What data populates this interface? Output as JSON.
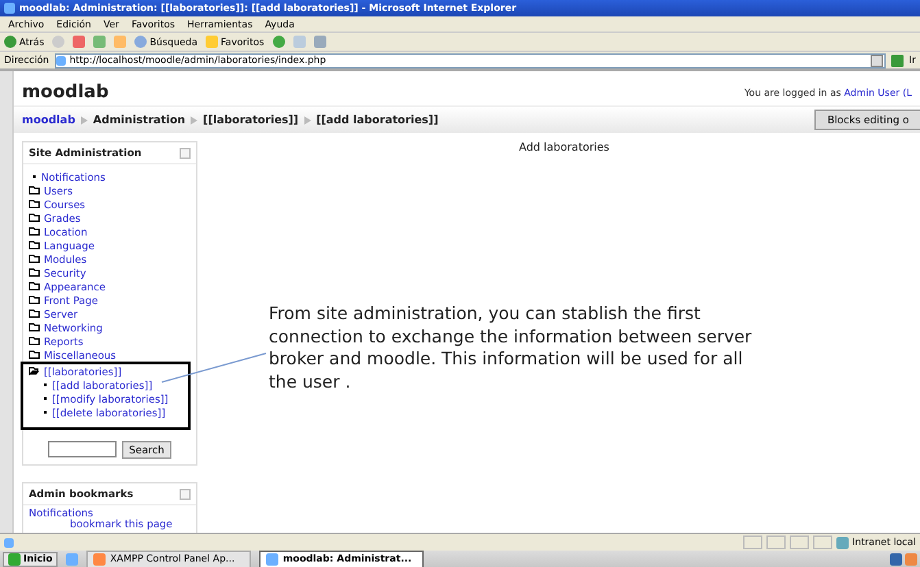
{
  "window": {
    "title": "moodlab: Administration: [[laboratories]]: [[add laboratories]] - Microsoft Internet Explorer"
  },
  "menu": [
    "Archivo",
    "Edición",
    "Ver",
    "Favoritos",
    "Herramientas",
    "Ayuda"
  ],
  "toolbar": {
    "back": "Atrás",
    "search": "Búsqueda",
    "favorites": "Favoritos"
  },
  "address": {
    "label": "Dirección",
    "value": "http://localhost/moodle/admin/laboratories/index.php",
    "go": "Ir"
  },
  "page": {
    "site_name": "moodlab",
    "login_text": "You are logged in as",
    "login_user": "Admin User (L",
    "breadcrumb": [
      {
        "label": "moodlab",
        "link": true
      },
      {
        "label": "Administration",
        "link": false
      },
      {
        "label": "[[laboratories]]",
        "link": false
      },
      {
        "label": "[[add laboratories]]",
        "link": false
      }
    ],
    "blocks_button": "Blocks editing o",
    "heading": "Add laboratories"
  },
  "sidebar": {
    "title": "Site Administration",
    "items": [
      {
        "label": "Notifications",
        "kind": "leaf"
      },
      {
        "label": "Users",
        "kind": "folder",
        "expanded": false
      },
      {
        "label": "Courses",
        "kind": "folder",
        "expanded": false
      },
      {
        "label": "Grades",
        "kind": "folder",
        "expanded": false
      },
      {
        "label": "Location",
        "kind": "folder",
        "expanded": false
      },
      {
        "label": "Language",
        "kind": "folder",
        "expanded": false
      },
      {
        "label": "Modules",
        "kind": "folder",
        "expanded": false
      },
      {
        "label": "Security",
        "kind": "folder",
        "expanded": false
      },
      {
        "label": "Appearance",
        "kind": "folder",
        "expanded": false
      },
      {
        "label": "Front Page",
        "kind": "folder",
        "expanded": false
      },
      {
        "label": "Server",
        "kind": "folder",
        "expanded": false
      },
      {
        "label": "Networking",
        "kind": "folder",
        "expanded": false
      },
      {
        "label": "Reports",
        "kind": "folder",
        "expanded": false
      },
      {
        "label": "Miscellaneous",
        "kind": "folder",
        "expanded": false
      },
      {
        "label": "[[laboratories]]",
        "kind": "folder",
        "expanded": true,
        "children": [
          {
            "label": "[[add laboratories]]"
          },
          {
            "label": "[[modify laboratories]]"
          },
          {
            "label": "[[delete laboratories]]"
          }
        ]
      }
    ],
    "search_button": "Search"
  },
  "bookmarks": {
    "title": "Admin bookmarks",
    "items": [
      "Notifications",
      "bookmark this page"
    ]
  },
  "callout": "From site administration, you can stablish the first connection to exchange the information between server broker and moodle. This information will be used for all the user .",
  "status_bar": {
    "zone": "Intranet local"
  },
  "taskbar": {
    "start": "Inicio",
    "tasks": [
      {
        "label": "XAMPP Control Panel Ap...",
        "selected": false
      },
      {
        "label": "moodlab: Administrat...",
        "selected": true
      }
    ]
  }
}
